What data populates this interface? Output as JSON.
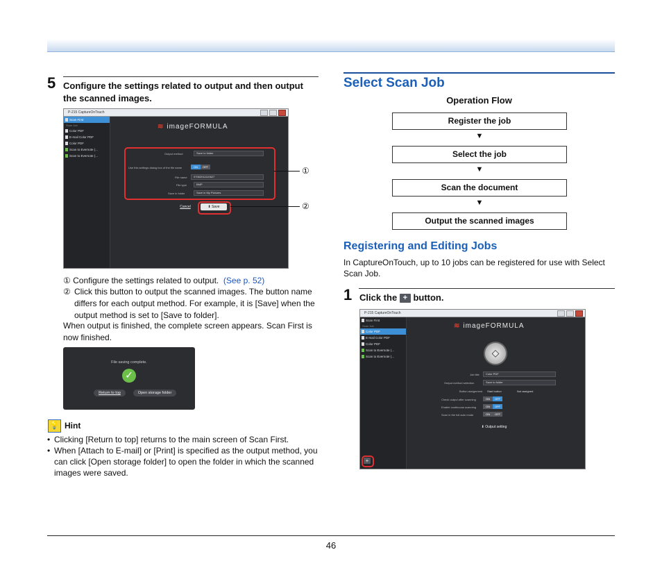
{
  "page_number": "46",
  "left": {
    "step5": {
      "num": "5",
      "text": "Configure the settings related to output and then output the scanned images."
    },
    "screenshot1": {
      "window_title": "P-215 CaptureOnTouch",
      "sidebar_top": "Scan First",
      "sidebar_group": "Scan Job",
      "sidebar_items": [
        "Color PDF",
        "E-mail Color PDF",
        "Color PDF",
        "Scan to Evernote (...",
        "Scan to Evernote (..."
      ],
      "logo": "imageFORMULA",
      "fields": [
        {
          "label": "Output method",
          "value": "Save to folder"
        },
        {
          "label": "Use this settings dialog box of the file name",
          "value": ""
        },
        {
          "label": "File name",
          "value": "07062011110627"
        },
        {
          "label": "File type",
          "value": "BMP"
        },
        {
          "label": "Save in folder",
          "value": "Save in My Pictures"
        }
      ],
      "toggle_on": "ON",
      "toggle_off": "OFF",
      "cancel": "Cancel",
      "save": "Save",
      "callout1": "①",
      "callout2": "②"
    },
    "note1_num": "①",
    "note1_text": "Configure the settings related to output.",
    "note1_link": "(See p. 52)",
    "note2_num": "②",
    "note2_text": "Click this button to output the scanned images. The button name differs for each output method. For example, it is [Save] when the output method is set to [Save to folder].",
    "after_text": "When output is finished, the complete screen appears. Scan First is now finished.",
    "complete_screen": {
      "message": "File saving complete.",
      "return_btn": "Return to top",
      "open_btn": "Open storage folder"
    },
    "hint_title": "Hint",
    "hint_bullets": [
      "Clicking [Return to top] returns to the main screen of Scan First.",
      "When [Attach to E-mail] or [Print] is specified as the output method, you can click [Open storage folder] to open the folder in which the scanned images were saved."
    ]
  },
  "right": {
    "title": "Select Scan Job",
    "operation_flow": "Operation Flow",
    "flow_steps": [
      "Register the job",
      "Select the job",
      "Scan the document",
      "Output the scanned images"
    ],
    "flow_arrow": "▼",
    "subtitle": "Registering and Editing Jobs",
    "intro": "In CaptureOnTouch, up to 10 jobs can be registered for use with Select Scan Job.",
    "step1": {
      "num": "1",
      "before": "Click the",
      "button_glyph": "+",
      "after": "button."
    },
    "screenshot2": {
      "window_title": "P-215 CaptureOnTouch",
      "sidebar_top": "Scan First",
      "sidebar_group": "Scan Job",
      "sidebar_items": [
        "Color PDF",
        "E-mail Color PDF",
        "Color PDF",
        "Scan to Evernote (...",
        "Scan to Evernote (..."
      ],
      "logo": "imageFORMULA",
      "fields": [
        {
          "label": "Job title",
          "value": "Color PDF"
        },
        {
          "label": "Output method selection",
          "value": "Save to folder"
        },
        {
          "label": "Button assignment",
          "value": "Start button"
        },
        {
          "label": "Check output after scanning",
          "value": ""
        },
        {
          "label": "Enable continuous scanning",
          "value": ""
        },
        {
          "label": "Scan in the full auto mode",
          "value": ""
        }
      ],
      "not_assigned": "Not assigned",
      "toggle_on": "ON",
      "toggle_off": "OFF",
      "output_setting": "Output setting",
      "plus": "+"
    }
  }
}
